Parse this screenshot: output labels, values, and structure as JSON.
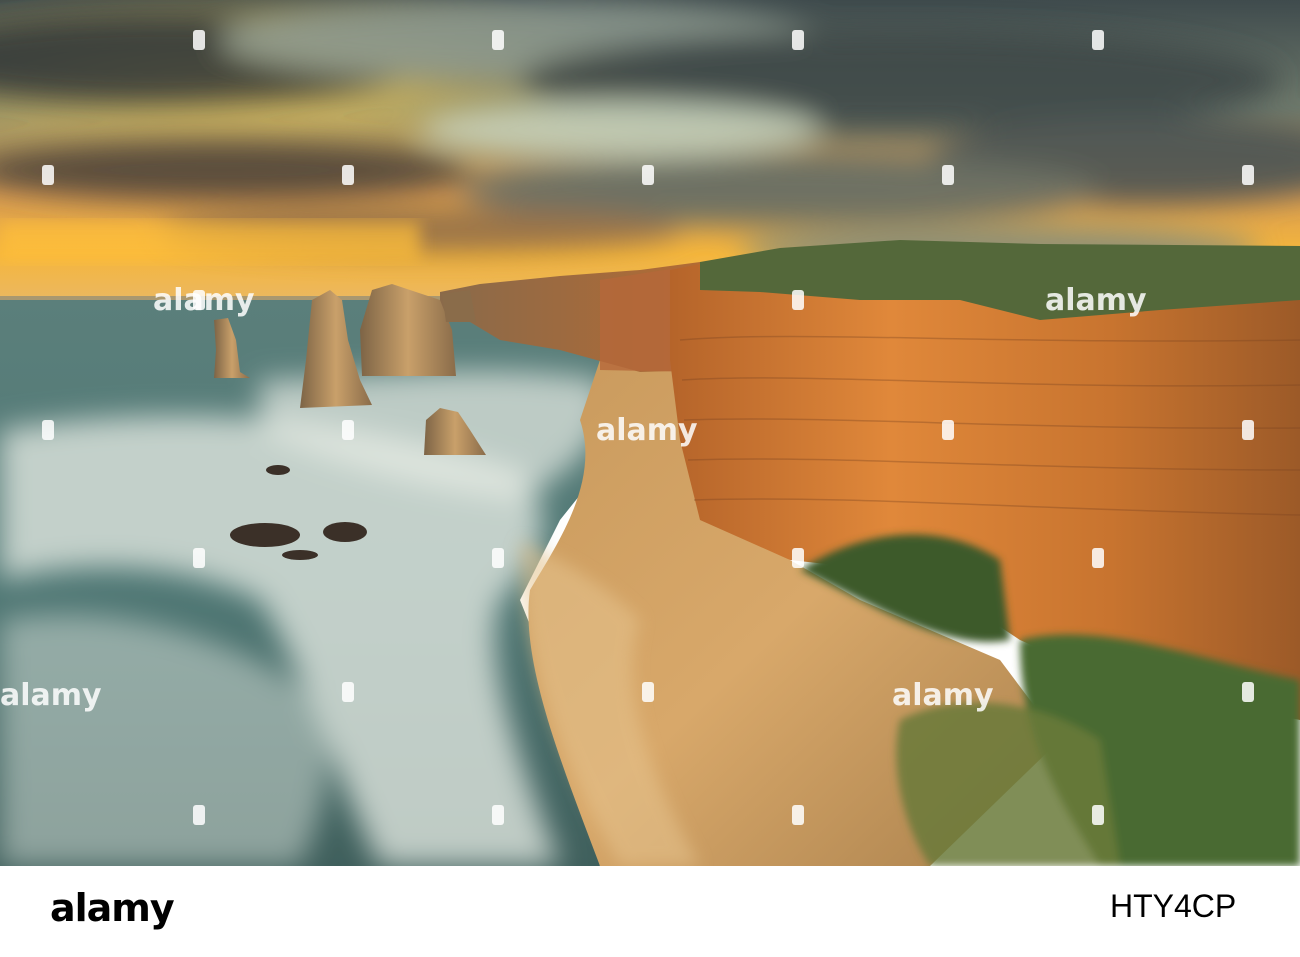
{
  "watermark": {
    "text": "alamy",
    "color": "#ffffff"
  },
  "footer": {
    "logo": "alamy",
    "image_id": "HTY4CP"
  },
  "colors": {
    "sky_top": "#3c4a4e",
    "sunset": "#f4b23a",
    "sea": "#4f7a76",
    "surf": "#dfe6df",
    "sand": "#d4a362",
    "cliff": "#c8752e",
    "vegetation": "#4d6a32"
  }
}
